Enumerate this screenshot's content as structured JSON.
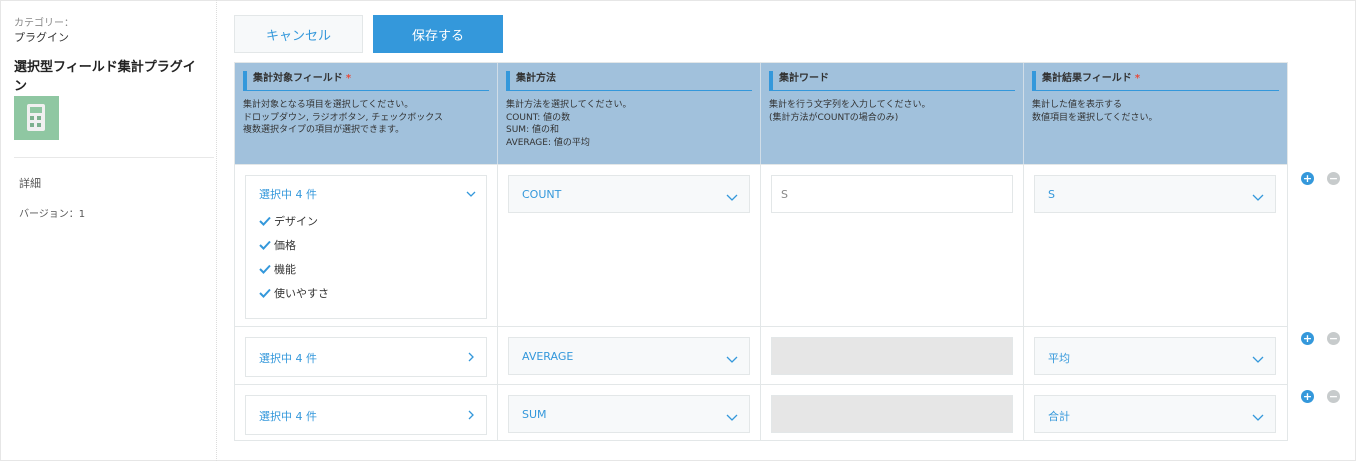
{
  "sidebar": {
    "category_label": "カテゴリー：",
    "category_value": "プラグイン",
    "plugin_name": "選択型フィールド集計プラグイン",
    "detail_label": "詳細",
    "version_text": "バージョン：1"
  },
  "toolbar": {
    "cancel_label": "キャンセル",
    "save_label": "保存する"
  },
  "columns": [
    {
      "title": "集計対象フィールド",
      "required_mark": "*",
      "desc": [
        "集計対象となる項目を選択してください。",
        "ドロップダウン, ラジオボタン, チェックボックス",
        "複数選択タイプの項目が選択できます。"
      ]
    },
    {
      "title": "集計方法",
      "required_mark": "",
      "desc": [
        "集計方法を選択してください。",
        "COUNT: 値の数",
        "SUM: 値の和",
        "AVERAGE: 値の平均"
      ]
    },
    {
      "title": "集計ワード",
      "required_mark": "",
      "desc": [
        "集計を行う文字列を入力してください。",
        "(集計方法がCOUNTの場合のみ)"
      ]
    },
    {
      "title": "集計結果フィールド",
      "required_mark": "*",
      "desc": [
        "集計した値を表示する",
        "数値項目を選択してください。"
      ]
    }
  ],
  "rows": [
    {
      "target": "選択中 4 件",
      "expanded": true,
      "options": [
        "デザイン",
        "価格",
        "機能",
        "使いやすさ"
      ],
      "method": "COUNT",
      "word": "S",
      "word_enabled": true,
      "result": "S"
    },
    {
      "target": "選択中 4 件",
      "expanded": false,
      "options": [],
      "method": "AVERAGE",
      "word": "",
      "word_enabled": false,
      "result": "平均"
    },
    {
      "target": "選択中 4 件",
      "expanded": false,
      "options": [],
      "method": "SUM",
      "word": "",
      "word_enabled": false,
      "result": "合計"
    }
  ],
  "row_actions": {
    "add": "+",
    "remove": "−"
  },
  "colors": {
    "accent": "#3498db",
    "header_bg": "#a1c1dc",
    "plugin_icon": "#8fc7a2",
    "required": "#e74c3c"
  },
  "icons": {
    "expanded": "chevron-down-icon",
    "collapsed": "chevron-right-icon",
    "select": "chevron-down-icon",
    "option": "check-icon"
  }
}
